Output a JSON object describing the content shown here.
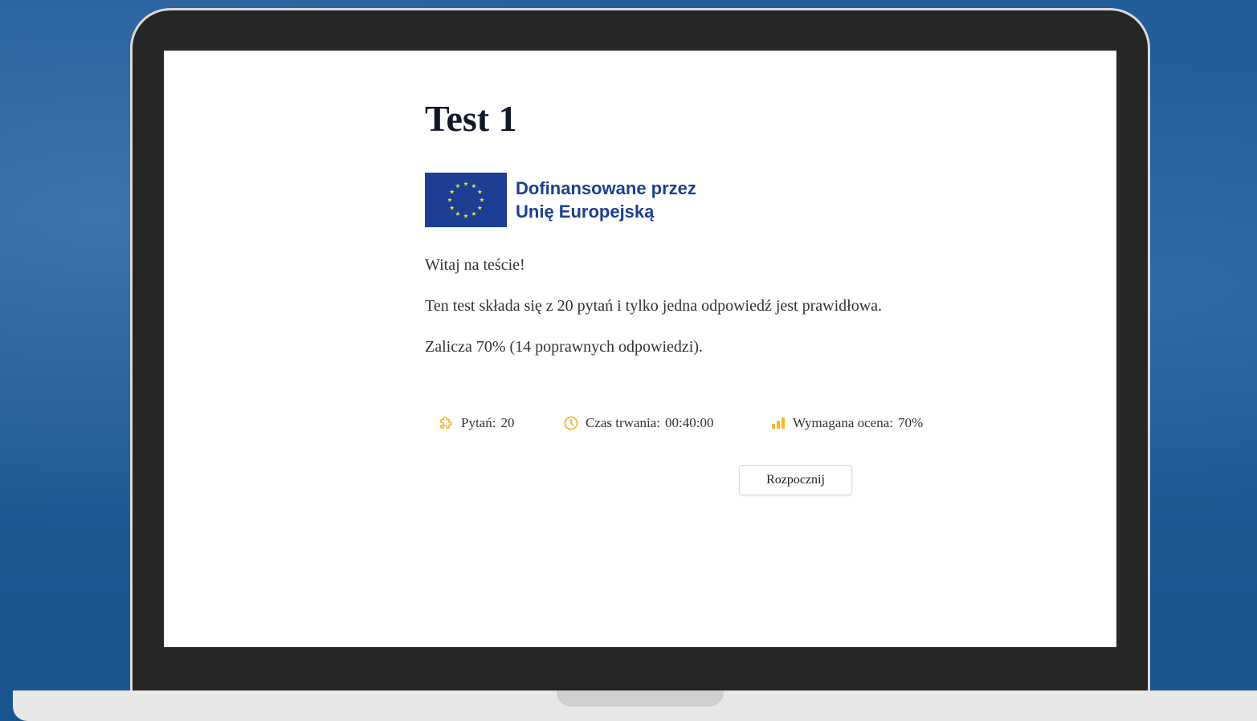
{
  "page": {
    "title": "Test 1"
  },
  "logo": {
    "line1": "Dofinansowane przez",
    "line2": "Unię Europejską",
    "flag_color": "#1c3f94",
    "star_color": "#ffdd00"
  },
  "intro": {
    "welcome": "Witaj na teście!",
    "description": "Ten test składa się z 20 pytań i tylko jedna odpowiedź jest prawidłowa.",
    "pass_info": "Zalicza 70% (14 poprawnych odpowiedzi)."
  },
  "stats": {
    "questions_label": "Pytań:",
    "questions_value": "20",
    "questions_icon": "puzzle-icon",
    "duration_label": "Czas trwania:",
    "duration_value": "00:40:00",
    "duration_icon": "clock-icon",
    "grade_label": "Wymagana ocena:",
    "grade_value": "70%",
    "grade_icon": "bar-chart-icon",
    "icon_color": "#f5b82e"
  },
  "actions": {
    "start_label": "Rozpocznij"
  }
}
